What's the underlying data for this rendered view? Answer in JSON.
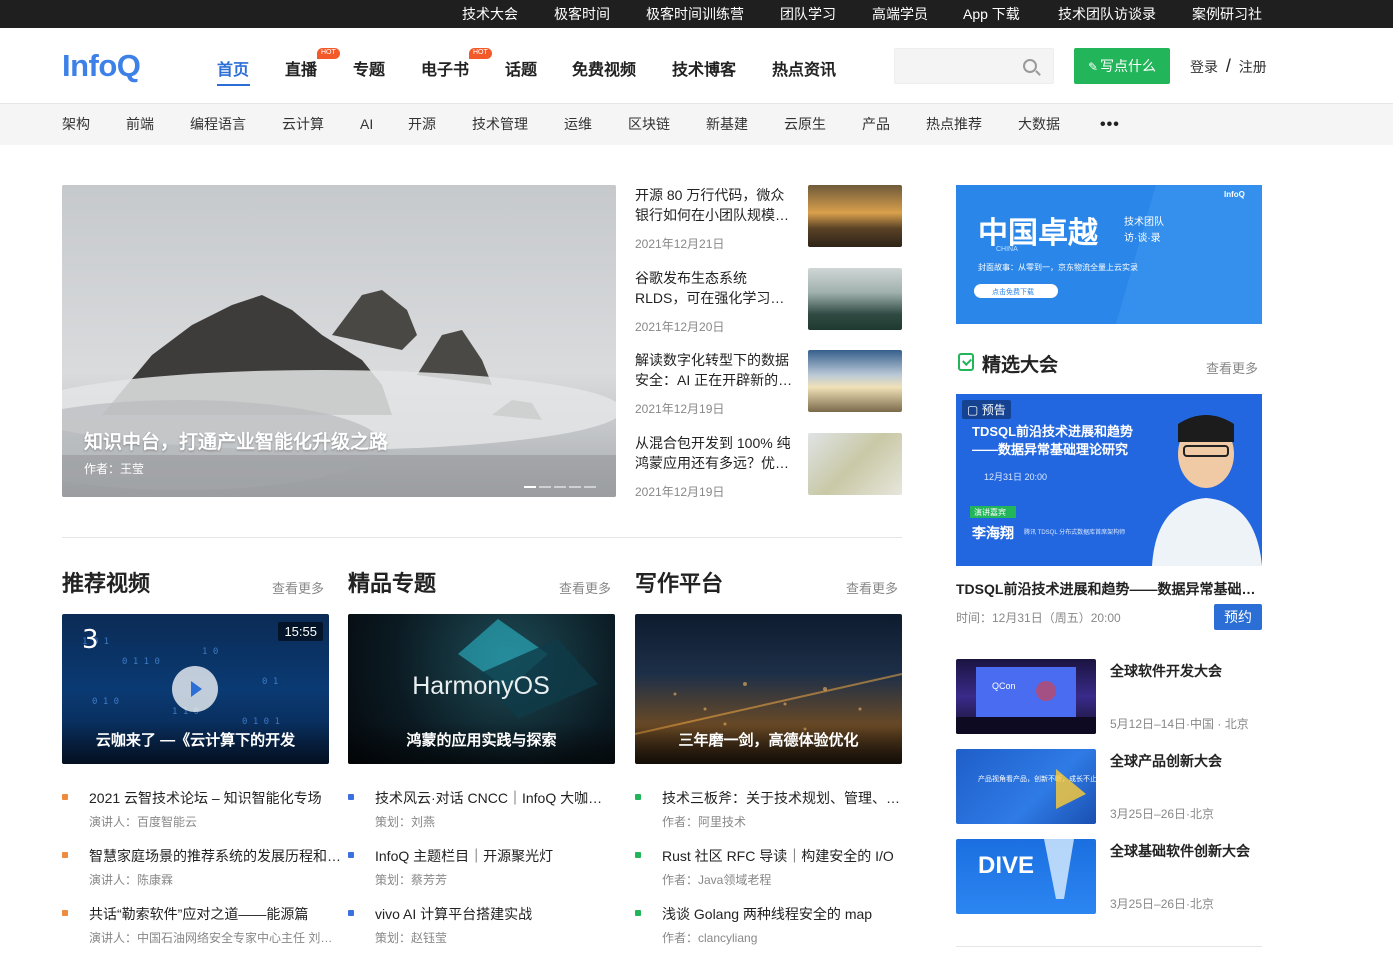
{
  "topbar": {
    "links": [
      "技术大会",
      "极客时间",
      "极客时间训练营",
      "团队学习",
      "高端学员",
      "App 下载",
      "技术团队访谈录",
      "案例研习社"
    ]
  },
  "header": {
    "logo": "InfoQ",
    "nav": [
      {
        "label": "首页",
        "active": true,
        "hot": false
      },
      {
        "label": "直播",
        "active": false,
        "hot": true
      },
      {
        "label": "专题",
        "active": false,
        "hot": false
      },
      {
        "label": "电子书",
        "active": false,
        "hot": true
      },
      {
        "label": "话题",
        "active": false,
        "hot": false
      },
      {
        "label": "免费视频",
        "active": false,
        "hot": false
      },
      {
        "label": "技术博客",
        "active": false,
        "hot": false
      },
      {
        "label": "热点资讯",
        "active": false,
        "hot": false
      }
    ],
    "hot_label": "HOT",
    "search_placeholder": "",
    "write_label": "写点什么",
    "login": "登录",
    "login_sep": "/",
    "register": "注册"
  },
  "subnav": {
    "items": [
      "架构",
      "前端",
      "编程语言",
      "云计算",
      "AI",
      "开源",
      "技术管理",
      "运维",
      "区块链",
      "新基建",
      "云原生",
      "产品",
      "热点推荐",
      "大数据"
    ],
    "more": "•••"
  },
  "hero": {
    "title": "知识中台，打通产业智能化升级之路",
    "author": "作者：王莹",
    "slides": 5,
    "active_slide": 0
  },
  "news": [
    {
      "title": "开源 80 万行代码，微众银行如何在小团队规模…",
      "date": "2021年12月21日"
    },
    {
      "title": "谷歌发布生态系统 RLDS，可在强化学习…",
      "date": "2021年12月20日"
    },
    {
      "title": "解读数字化转型下的数据安全：AI 正在开辟新的…",
      "date": "2021年12月19日"
    },
    {
      "title": "从混合包开发到 100% 纯鸿蒙应用还有多远？优…",
      "date": "2021年12月19日"
    }
  ],
  "sections": [
    {
      "title": "推荐视频",
      "more": "查看更多",
      "card_title": "云咖来了 —《云计算下的开发",
      "duration": "15:55",
      "bullet_color": "#f08a3c",
      "items": [
        {
          "title": "2021 云智技术论坛 – 知识智能化专场",
          "sub": "演讲人：百度智能云"
        },
        {
          "title": "智慧家庭场景的推荐系统的发展历程和…",
          "sub": "演讲人：陈康霖"
        },
        {
          "title": "共话“勒索软件”应对之道——能源篇",
          "sub": "演讲人：中国石油网络安全专家中心主任 刘磊…"
        }
      ]
    },
    {
      "title": "精品专题",
      "more": "查看更多",
      "card_title": "鸿蒙的应用实践与探索",
      "card_brand": "HarmonyOS",
      "bullet_color": "#3c6fe0",
      "items": [
        {
          "title": "技术风云·对话 CNCC｜InfoQ 大咖…",
          "sub": "策划：刘燕"
        },
        {
          "title": "InfoQ 主题栏目｜开源聚光灯",
          "sub": "策划：蔡芳芳"
        },
        {
          "title": "vivo AI 计算平台搭建实战",
          "sub": "策划：赵钰莹"
        }
      ]
    },
    {
      "title": "写作平台",
      "more": "查看更多",
      "card_title": "三年磨一剑，高德体验优化",
      "bullet_color": "#22b55a",
      "items": [
        {
          "title": "技术三板斧：关于技术规划、管理、…",
          "sub": "作者：阿里技术"
        },
        {
          "title": "Rust 社区 RFC 导读｜构建安全的 I/O",
          "sub": "作者：Java领域老程"
        },
        {
          "title": "浅谈 Golang 两种线程安全的 map",
          "sub": "作者：clancyliang"
        }
      ]
    }
  ],
  "sidebar": {
    "banner": {
      "brand": "InfoQ",
      "title": "中国卓越",
      "badge_line1": "技术团队",
      "badge_line2": "访·谈·录",
      "china": "CHINA",
      "story": "封面故事：从零到一，京东物流全量上云实录",
      "cta": "点击免费下载"
    },
    "events_title": "精选大会",
    "events_more": "查看更多",
    "live": {
      "badge": "预告",
      "card_line1": "TDSQL前沿技术进展和趋势",
      "card_line2": "——数据异常基础理论研究",
      "card_time": "12月31日 20:00",
      "speaker_tag": "演讲嘉宾",
      "speaker": "李海翔",
      "speaker_desc": "腾讯 TDSQL 分布式数据库首席架构师",
      "title": "TDSQL前沿技术进展和趋势——数据异常基础…",
      "time": "时间：12月31日（周五）20:00",
      "reserve": "预约"
    },
    "conferences": [
      {
        "name": "全球软件开发大会",
        "date": "5月12日–14日·中国 · 北京",
        "thumb_text": "QCon"
      },
      {
        "name": "全球产品创新大会",
        "date": "3月25日–26日·北京",
        "thumb_text": "产品视角看产品，创新不断，成长不止"
      },
      {
        "name": "全球基础软件创新大会",
        "date": "3月25日–26日·北京",
        "thumb_text": "DIVE"
      }
    ]
  }
}
